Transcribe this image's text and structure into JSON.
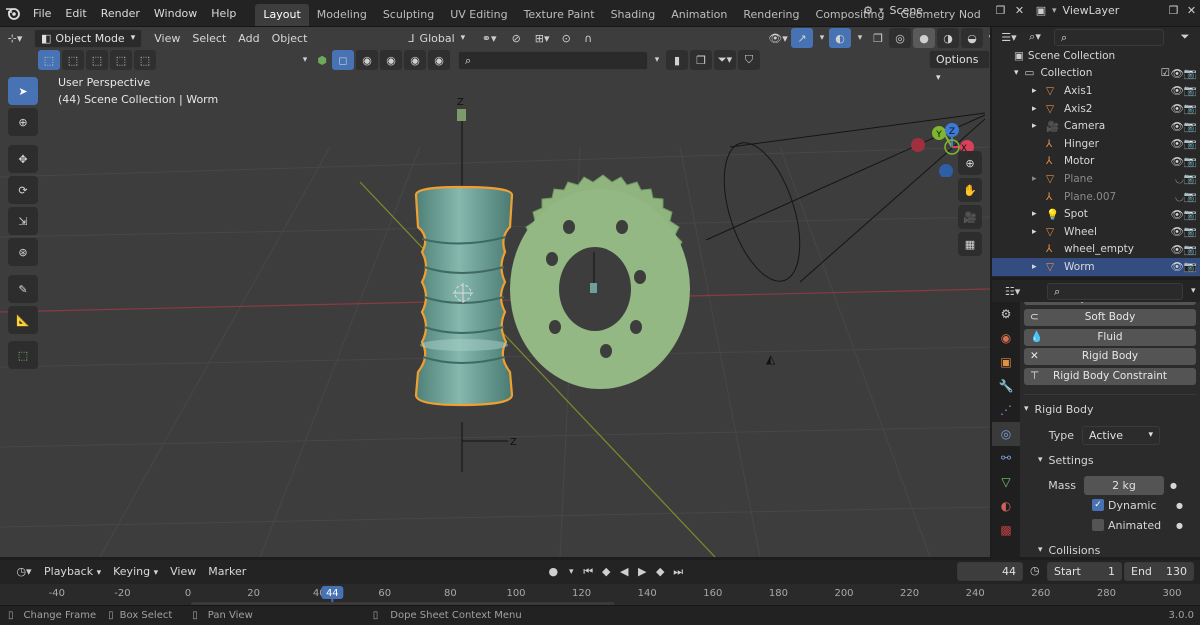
{
  "topbar": {
    "menus": [
      "File",
      "Edit",
      "Render",
      "Window",
      "Help"
    ],
    "workspaces": [
      "Layout",
      "Modeling",
      "Sculpting",
      "UV Editing",
      "Texture Paint",
      "Shading",
      "Animation",
      "Rendering",
      "Compositing",
      "Geometry Nod"
    ],
    "active_workspace": "Layout",
    "scene_name": "Scene",
    "viewlayer_name": "ViewLayer"
  },
  "viewport": {
    "mode": "Object Mode",
    "menus": [
      "View",
      "Select",
      "Add",
      "Object"
    ],
    "transform_orientation": "Global",
    "options_label": "Options",
    "overlay_title": "User Perspective",
    "overlay_subtitle": "(44) Scene Collection | Worm",
    "gizmo_axes": [
      "Z",
      "Y",
      "X"
    ],
    "object_axes": [
      "Z",
      "Z"
    ]
  },
  "outliner": {
    "root": "Scene Collection",
    "collection": "Collection",
    "items": [
      {
        "name": "Axis1",
        "type": "mesh",
        "dim": false,
        "selected": false
      },
      {
        "name": "Axis2",
        "type": "mesh",
        "dim": false,
        "selected": false
      },
      {
        "name": "Camera",
        "type": "camera",
        "dim": false,
        "selected": false
      },
      {
        "name": "Hinger",
        "type": "empty",
        "dim": false,
        "selected": false
      },
      {
        "name": "Motor",
        "type": "empty",
        "dim": false,
        "selected": false
      },
      {
        "name": "Plane",
        "type": "mesh",
        "dim": true,
        "selected": false
      },
      {
        "name": "Plane.007",
        "type": "empty",
        "dim": true,
        "selected": false
      },
      {
        "name": "Spot",
        "type": "light",
        "dim": false,
        "selected": false
      },
      {
        "name": "Wheel",
        "type": "mesh",
        "dim": false,
        "selected": false
      },
      {
        "name": "wheel_empty",
        "type": "empty",
        "dim": false,
        "selected": false
      },
      {
        "name": "Worm",
        "type": "mesh",
        "dim": false,
        "selected": true
      }
    ]
  },
  "properties": {
    "partial_top": "Dynamic Paint",
    "physics_buttons": [
      "Soft Body",
      "Fluid",
      "Rigid Body",
      "Rigid Body Constraint"
    ],
    "rigid_body_panel": "Rigid Body",
    "type_label": "Type",
    "type_value": "Active",
    "settings_panel": "Settings",
    "mass_label": "Mass",
    "mass_value": "2 kg",
    "dynamic_label": "Dynamic",
    "dynamic_checked": true,
    "animated_label": "Animated",
    "animated_checked": false,
    "collisions_panel": "Collisions"
  },
  "timeline": {
    "menus": [
      "Playback",
      "Keying",
      "View",
      "Marker"
    ],
    "current_frame": "44",
    "start_label": "Start",
    "start_value": "1",
    "end_label": "End",
    "end_value": "130",
    "ruler": [
      "-40",
      "-20",
      "0",
      "20",
      "40",
      "44",
      "60",
      "80",
      "100",
      "120",
      "140",
      "160",
      "180",
      "200",
      "220",
      "240",
      "260",
      "280",
      "300"
    ]
  },
  "statusbar": {
    "items": [
      "Change Frame",
      "Box Select",
      "Pan View",
      "Dope Sheet Context Menu"
    ],
    "version": "3.0.0"
  },
  "colors": {
    "accent": "#4772b3",
    "selection_orange": "#f0a030",
    "worm": "#6fa39b",
    "wheel": "#8fb47e",
    "axis_x": "#d9405a",
    "axis_y": "#7fb62f",
    "axis_z": "#3d7ad6"
  }
}
